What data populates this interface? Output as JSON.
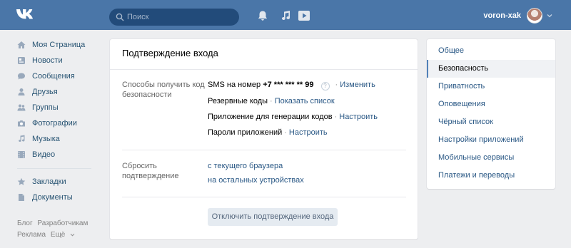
{
  "header": {
    "logo_text": "VK",
    "search_placeholder": "Поиск",
    "username": "voron-xak",
    "icons": [
      "vk-logo-icon",
      "search-icon",
      "bell-icon",
      "music-note-icon",
      "play-icon",
      "avatar",
      "chevron-down-icon"
    ]
  },
  "sidebar": {
    "items": [
      {
        "label": "Моя Страница",
        "icon": "home-icon"
      },
      {
        "label": "Новости",
        "icon": "news-icon"
      },
      {
        "label": "Сообщения",
        "icon": "message-icon"
      },
      {
        "label": "Друзья",
        "icon": "friend-icon"
      },
      {
        "label": "Группы",
        "icon": "group-icon"
      },
      {
        "label": "Фотографии",
        "icon": "camera-icon"
      },
      {
        "label": "Музыка",
        "icon": "music-icon"
      },
      {
        "label": "Видео",
        "icon": "video-icon"
      }
    ],
    "extra_items": [
      {
        "label": "Закладки",
        "icon": "star-icon"
      },
      {
        "label": "Документы",
        "icon": "document-icon"
      }
    ],
    "footer": {
      "blog": "Блог",
      "developers": "Разработчикам",
      "ads": "Реклама",
      "more": "Ещё"
    }
  },
  "main": {
    "title": "Подтверждение входа",
    "methods_label": "Способы получить код безопасности",
    "sms_prefix": "SMS на номер",
    "phone": "+7 *** *** ** 99",
    "help_symbol": "?",
    "change_link": "Изменить",
    "backup_codes_label": "Резервные коды",
    "show_list_link": "Показать список",
    "app_codes_label": "Приложение для генерации кодов",
    "app_codes_link": "Настроить",
    "app_passwords_label": "Пароли приложений",
    "app_passwords_link": "Настроить",
    "separator_dot": "·",
    "reset_label": "Сбросить подтверждение",
    "reset_current_browser": "с текущего браузера",
    "reset_other_devices": "на остальных устройствах",
    "disable_button": "Отключить подтверждение входа"
  },
  "settings_menu": {
    "items": [
      "Общее",
      "Безопасность",
      "Приватность",
      "Оповещения",
      "Чёрный список",
      "Настройки приложений",
      "Мобильные сервисы",
      "Платежи и переводы"
    ],
    "active_index": 1
  },
  "colors": {
    "header_bg": "#4a76a8",
    "link": "#2a5885",
    "page_bg": "#edeef0"
  }
}
